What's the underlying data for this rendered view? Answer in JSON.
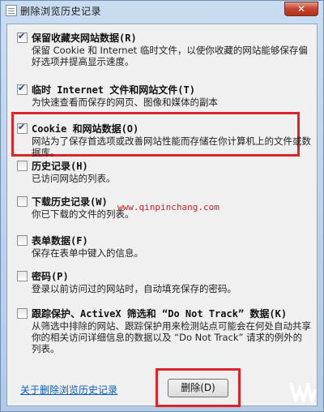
{
  "window": {
    "title": "删除浏览历史记录",
    "close_glyph": "✕"
  },
  "options": [
    {
      "title": "保留收藏夹网站数据(R)",
      "desc": "保留 Cookie 和 Internet 临时文件，以使你收藏的网站能够保存偏好选项并提高显示速度。",
      "checked": true
    },
    {
      "title": "临时 Internet 文件和网站文件(T)",
      "desc": "为快速查看而保存的网页、图像和媒体的副本",
      "checked": true
    },
    {
      "title": "Cookie 和网站数据(O)",
      "desc": "网站为了保存首选项或改善网站性能而存储在你计算机上的文件或数据库。",
      "checked": true
    },
    {
      "title": "历史记录(H)",
      "desc": "已访问网站的列表。",
      "checked": false
    },
    {
      "title": "下载历史记录(W)",
      "desc": "你已下载的文件的列表。",
      "checked": false
    },
    {
      "title": "表单数据(F)",
      "desc": "保存在表单中键入的信息。",
      "checked": false
    },
    {
      "title": "密码(P)",
      "desc": "登录以前访问过的网站时，自动填充保存的密码。",
      "checked": false
    },
    {
      "title": "跟踪保护、ActiveX 筛选和 “Do Not Track” 数据(K)",
      "desc": "从筛选中排除的网站、跟踪保护用来检测站点可能会在何处自动共享你的相关访问详细信息的数据以及 “Do Not Track” 请求的例外的列表。",
      "checked": false
    }
  ],
  "watermark": "www.qinpinchang.com",
  "footer": {
    "about_link": "关于删除浏览历史记录",
    "delete_button": "删除(D)"
  },
  "colors": {
    "highlight": "#d9262b",
    "link": "#0b5ec2",
    "close": "#c5432c"
  }
}
